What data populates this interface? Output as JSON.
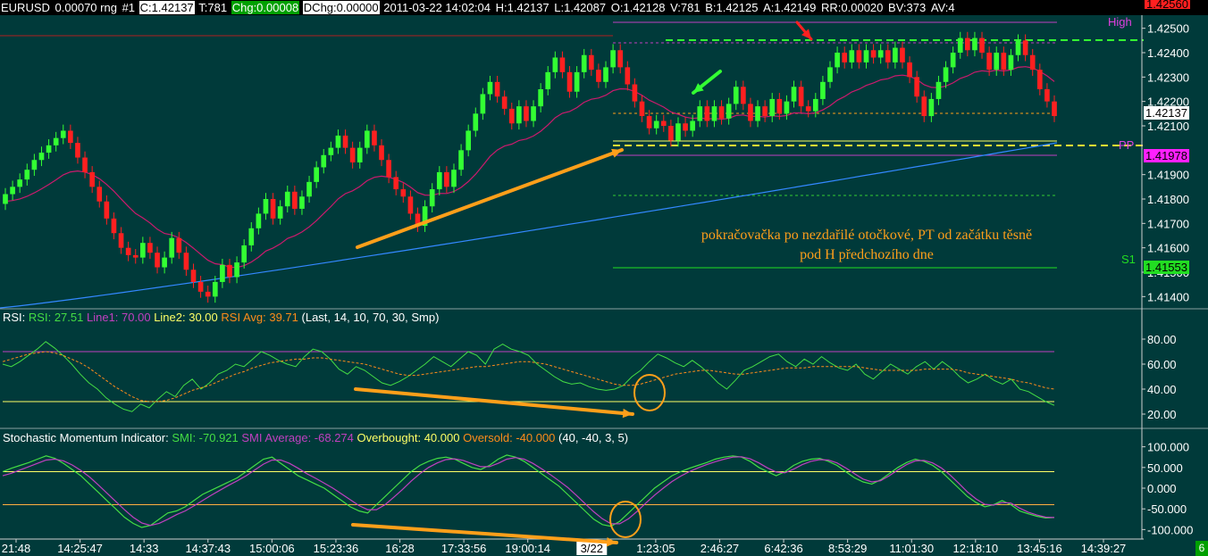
{
  "header": {
    "symbol": "EURUSD",
    "range": "0.00070 rng",
    "num": "#1",
    "close": "C:1.42137",
    "ticks": "T:781",
    "chg": "Chg:0.00008",
    "dchg": "DChg:0.00000",
    "datetime": "2011-03-22 14:02:04",
    "high": "H:1.42137",
    "low": "L:1.42087",
    "open": "O:1.42128",
    "vol": "V:781",
    "bid": "B:1.42125",
    "ask": "A:1.42149",
    "rr": "RR:0.00020",
    "bv": "BV:373",
    "av": "AV:4"
  },
  "price_axis": {
    "ticks": [
      "1.42500",
      "1.42400",
      "1.42300",
      "1.42200",
      "1.42100",
      "1.41900",
      "1.41800",
      "1.41700",
      "1.41600",
      "1.41500",
      "1.41400"
    ],
    "top_label": "1.42560",
    "last_label": "1.42137",
    "pp_label": "1.41978",
    "s1_label": "1.41553"
  },
  "level_labels": {
    "high": "High",
    "pp": "PP",
    "s1": "S1"
  },
  "rsi_legend": {
    "name": "RSI:",
    "rsi": "RSI: 27.51",
    "line1": "Line1: 70.00",
    "line2": "Line2: 30.00",
    "avg": "RSI Avg: 39.71",
    "params": "(Last, 14, 10, 70, 30, Smp)"
  },
  "rsi_axis": [
    "80.00",
    "60.00",
    "40.00",
    "20.00"
  ],
  "smi_legend": {
    "name": "Stochastic Momentum Indicator:",
    "smi": "SMI: -70.921",
    "avg": "SMI Average: -68.274",
    "ob": "Overbought: 40.000",
    "os": "Oversold: -40.000",
    "params": "(40, -40, 3, 5)"
  },
  "smi_axis": [
    "100.000",
    "50.000",
    "0.000",
    "-50.000",
    "-100.000"
  ],
  "time_axis": [
    "21:48",
    "14:25:47",
    "14:33",
    "14:37:43",
    "15:00:06",
    "15:23:36",
    "16:28",
    "17:33:56",
    "19:00:14",
    "3/22",
    "1:23:05",
    "2:46:27",
    "6:42:36",
    "8:53:29",
    "11:01:30",
    "12:18:10",
    "13:45:16",
    "14:39:27"
  ],
  "annotation": {
    "line1": "pokračovačka po nezdařilé otočkové, PT od začátku těsně",
    "line2": "pod H předchozího dne"
  },
  "corner": "6",
  "colors": {
    "background": "#003a3a",
    "bull": "#33ff33",
    "bear": "#ff2020",
    "ma_fast": "#cc1a6e",
    "ma_slow": "#3388ff",
    "arrow": "#ff9f1a",
    "rsi_line": "#44dd44",
    "rsi_avg": "#ff8c1a",
    "smi_line": "#44dd44",
    "smi_avg": "#c040c0"
  },
  "chart_data": [
    {
      "type": "candlestick",
      "title": "EURUSD 0.00070 rng",
      "ylim": [
        1.4135,
        1.4255
      ],
      "closes": [
        1.4182,
        1.4185,
        1.4188,
        1.4192,
        1.4196,
        1.4199,
        1.4202,
        1.4205,
        1.4208,
        1.4203,
        1.4197,
        1.4191,
        1.4185,
        1.4179,
        1.4172,
        1.4166,
        1.416,
        1.4157,
        1.4156,
        1.4162,
        1.4158,
        1.4152,
        1.4156,
        1.4164,
        1.4158,
        1.4151,
        1.4146,
        1.4142,
        1.414,
        1.4146,
        1.4153,
        1.4148,
        1.4154,
        1.4161,
        1.4168,
        1.4174,
        1.418,
        1.4172,
        1.4177,
        1.4183,
        1.4176,
        1.4181,
        1.4187,
        1.4193,
        1.4198,
        1.4201,
        1.4206,
        1.4201,
        1.4195,
        1.4201,
        1.4208,
        1.4202,
        1.4196,
        1.4189,
        1.4184,
        1.4181,
        1.4174,
        1.4169,
        1.4177,
        1.4184,
        1.4191,
        1.4185,
        1.4192,
        1.42,
        1.4208,
        1.4215,
        1.4223,
        1.4228,
        1.4222,
        1.4217,
        1.4211,
        1.4218,
        1.4212,
        1.4218,
        1.4225,
        1.4232,
        1.4238,
        1.4232,
        1.4224,
        1.4232,
        1.4239,
        1.4233,
        1.4228,
        1.4234,
        1.4241,
        1.4234,
        1.4227,
        1.422,
        1.4214,
        1.4209,
        1.4212,
        1.421,
        1.4204,
        1.4211,
        1.4208,
        1.4212,
        1.4218,
        1.4212,
        1.4218,
        1.4213,
        1.4219,
        1.4226,
        1.4219,
        1.4212,
        1.4218,
        1.4214,
        1.4221,
        1.4215,
        1.422,
        1.4226,
        1.4218,
        1.4216,
        1.4221,
        1.4228,
        1.4234,
        1.424,
        1.4236,
        1.4241,
        1.4236,
        1.4241,
        1.4238,
        1.4241,
        1.4236,
        1.4242,
        1.4236,
        1.423,
        1.4222,
        1.4214,
        1.4221,
        1.4228,
        1.4234,
        1.424,
        1.4246,
        1.4241,
        1.4246,
        1.424,
        1.4233,
        1.424,
        1.4233,
        1.4239,
        1.4245,
        1.4239,
        1.4233,
        1.4225,
        1.422,
        1.4214
      ]
    },
    {
      "type": "line",
      "title": "RSI",
      "ylim": [
        10,
        90
      ],
      "series": [
        {
          "name": "RSI",
          "values": [
            60,
            58,
            62,
            67,
            72,
            78,
            73,
            67,
            60,
            52,
            45,
            40,
            33,
            28,
            24,
            22,
            28,
            25,
            32,
            38,
            34,
            43,
            48,
            40,
            45,
            52,
            55,
            60,
            58,
            64,
            70,
            67,
            63,
            60,
            58,
            66,
            72,
            70,
            64,
            56,
            52,
            58,
            55,
            50,
            45,
            43,
            46,
            50,
            55,
            60,
            66,
            62,
            58,
            64,
            70,
            67,
            60,
            72,
            76,
            72,
            70,
            67,
            60,
            55,
            50,
            46,
            44,
            45,
            42,
            40,
            39,
            40,
            43,
            50,
            55,
            62,
            68,
            65,
            61,
            58,
            63,
            58,
            52,
            45,
            40,
            47,
            55,
            58,
            62,
            66,
            68,
            62,
            58,
            64,
            60,
            66,
            61,
            57,
            55,
            60,
            52,
            48,
            54,
            60,
            56,
            52,
            58,
            62,
            56,
            62,
            57,
            50,
            45,
            48,
            52,
            47,
            44,
            48,
            40,
            38,
            34,
            30,
            27
          ]
        },
        {
          "name": "RSI Avg",
          "values": [
            62,
            64,
            66,
            68,
            69,
            70,
            69,
            67,
            64,
            61,
            57,
            52,
            47,
            42,
            38,
            34,
            31,
            30,
            30,
            31,
            33,
            36,
            39,
            41,
            43,
            46,
            49,
            52,
            54,
            57,
            59,
            61,
            62,
            63,
            64,
            64,
            65,
            65,
            64,
            63,
            62,
            61,
            60,
            58,
            56,
            54,
            52,
            51,
            51,
            52,
            53,
            54,
            55,
            56,
            57,
            58,
            58,
            59,
            60,
            61,
            62,
            62,
            61,
            60,
            58,
            56,
            54,
            52,
            50,
            48,
            46,
            44,
            43,
            43,
            44,
            46,
            48,
            50,
            52,
            53,
            54,
            55,
            55,
            54,
            53,
            52,
            52,
            53,
            54,
            55,
            56,
            57,
            57,
            57,
            58,
            58,
            58,
            58,
            58,
            58,
            57,
            56,
            55,
            55,
            55,
            55,
            55,
            56,
            56,
            56,
            56,
            55,
            53,
            52,
            51,
            50,
            49,
            48,
            46,
            45,
            43,
            41,
            40
          ]
        }
      ],
      "lines": [
        70,
        30
      ]
    },
    {
      "type": "line",
      "title": "Stochastic Momentum Indicator",
      "ylim": [
        -110,
        110
      ],
      "series": [
        {
          "name": "SMI",
          "values": [
            40,
            48,
            55,
            62,
            70,
            78,
            72,
            60,
            45,
            30,
            10,
            -10,
            -30,
            -50,
            -70,
            -85,
            -95,
            -90,
            -75,
            -60,
            -55,
            -45,
            -30,
            -15,
            -5,
            5,
            15,
            25,
            40,
            55,
            70,
            75,
            60,
            45,
            30,
            20,
            10,
            0,
            -15,
            -30,
            -45,
            -55,
            -60,
            -40,
            -20,
            0,
            20,
            40,
            55,
            65,
            72,
            75,
            70,
            60,
            50,
            45,
            55,
            70,
            80,
            75,
            65,
            50,
            35,
            20,
            5,
            -15,
            -35,
            -55,
            -75,
            -88,
            -92,
            -80,
            -60,
            -40,
            -20,
            0,
            15,
            30,
            40,
            48,
            55,
            62,
            70,
            75,
            78,
            75,
            65,
            50,
            40,
            30,
            40,
            55,
            65,
            70,
            72,
            65,
            55,
            40,
            25,
            15,
            10,
            20,
            35,
            50,
            62,
            70,
            65,
            55,
            40,
            20,
            0,
            -20,
            -35,
            -45,
            -40,
            -30,
            -40,
            -55,
            -62,
            -68,
            -72,
            -71
          ]
        },
        {
          "name": "SMI Average",
          "values": [
            30,
            36,
            44,
            52,
            60,
            68,
            70,
            66,
            56,
            43,
            27,
            8,
            -12,
            -32,
            -52,
            -70,
            -84,
            -90,
            -85,
            -75,
            -64,
            -55,
            -43,
            -30,
            -17,
            -5,
            7,
            18,
            30,
            44,
            58,
            68,
            68,
            60,
            48,
            35,
            24,
            12,
            0,
            -14,
            -28,
            -42,
            -52,
            -52,
            -40,
            -22,
            -3,
            17,
            35,
            50,
            61,
            69,
            71,
            67,
            59,
            52,
            52,
            60,
            70,
            74,
            70,
            60,
            47,
            33,
            18,
            2,
            -17,
            -37,
            -57,
            -74,
            -86,
            -86,
            -74,
            -56,
            -36,
            -17,
            0,
            16,
            29,
            40,
            49,
            57,
            64,
            70,
            75,
            76,
            71,
            61,
            49,
            39,
            37,
            46,
            57,
            65,
            69,
            68,
            61,
            49,
            35,
            22,
            15,
            18,
            30,
            44,
            57,
            66,
            67,
            61,
            49,
            32,
            12,
            -9,
            -26,
            -39,
            -41,
            -35,
            -36,
            -48,
            -58,
            -65,
            -70,
            -71
          ]
        }
      ],
      "lines": [
        40,
        -40
      ]
    }
  ]
}
